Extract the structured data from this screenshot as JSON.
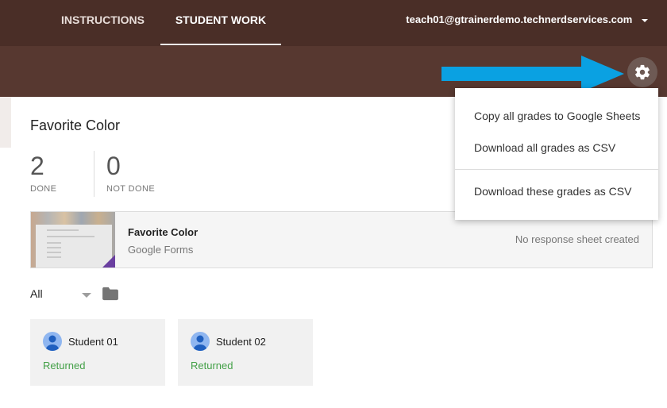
{
  "header": {
    "tabs": [
      {
        "label": "INSTRUCTIONS",
        "active": false
      },
      {
        "label": "STUDENT WORK",
        "active": true
      }
    ],
    "account": "teach01@gtrainerdemo.technerdservices.com"
  },
  "assignment": {
    "title": "Favorite Color",
    "stats": {
      "done_count": "2",
      "done_label": "DONE",
      "not_done_count": "0",
      "not_done_label": "NOT DONE"
    },
    "attachment": {
      "title": "Favorite Color",
      "type": "Google Forms",
      "status": "No response sheet created"
    }
  },
  "filter": {
    "selected": "All"
  },
  "students": [
    {
      "name": "Student 01",
      "status": "Returned"
    },
    {
      "name": "Student 02",
      "status": "Returned"
    }
  ],
  "menu": {
    "items": [
      "Copy all grades to Google Sheets",
      "Download all grades as CSV",
      "Download these grades as CSV"
    ]
  },
  "colors": {
    "header_bg": "#4a2e27",
    "band_bg": "#573830",
    "returned_green": "#43a047",
    "arrow_blue": "#0aa1e2",
    "form_purple": "#6a3fa0"
  },
  "icons": {
    "settings": "gear-icon",
    "folder": "folder-icon",
    "avatar": "person-avatar-icon",
    "account_caret": "chevron-down-icon"
  }
}
